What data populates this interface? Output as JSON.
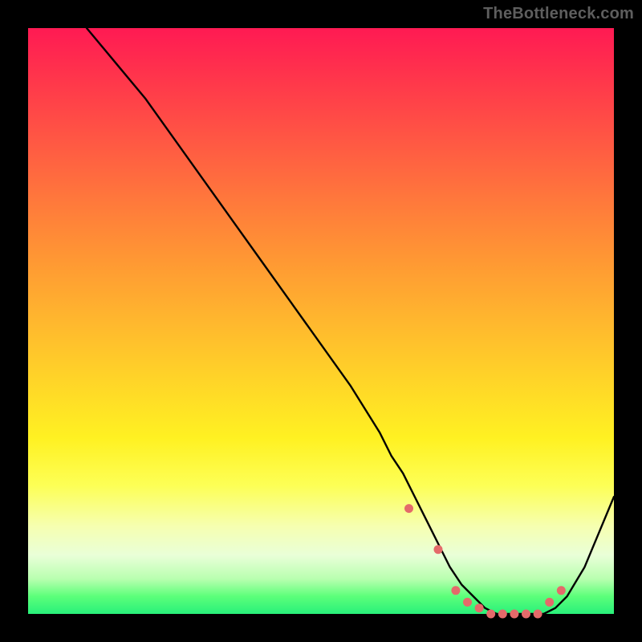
{
  "credit_text": "TheBottleneck.com",
  "chart_data": {
    "type": "line",
    "title": "",
    "xlabel": "",
    "ylabel": "",
    "xlim": [
      0,
      100
    ],
    "ylim": [
      0,
      100
    ],
    "series": [
      {
        "name": "bottleneck-curve",
        "x": [
          10,
          15,
          20,
          25,
          30,
          35,
          40,
          45,
          50,
          55,
          60,
          62,
          64,
          66,
          68,
          70,
          72,
          74,
          76,
          78,
          80,
          82,
          84,
          86,
          88,
          90,
          92,
          95,
          100
        ],
        "y": [
          100,
          94,
          88,
          81,
          74,
          67,
          60,
          53,
          46,
          39,
          31,
          27,
          24,
          20,
          16,
          12,
          8,
          5,
          3,
          1,
          0,
          0,
          0,
          0,
          0,
          1,
          3,
          8,
          20
        ]
      }
    ],
    "markers": {
      "name": "highlight-dots",
      "x": [
        65,
        70,
        73,
        75,
        77,
        79,
        81,
        83,
        85,
        87,
        89,
        91
      ],
      "y": [
        18,
        11,
        4,
        2,
        1,
        0,
        0,
        0,
        0,
        0,
        2,
        4
      ]
    },
    "gradient": {
      "top": "#ff1a53",
      "mid": "#ffe726",
      "bottom": "#28f07a"
    },
    "curve_color": "#000000",
    "marker_color": "#e46a6a"
  }
}
